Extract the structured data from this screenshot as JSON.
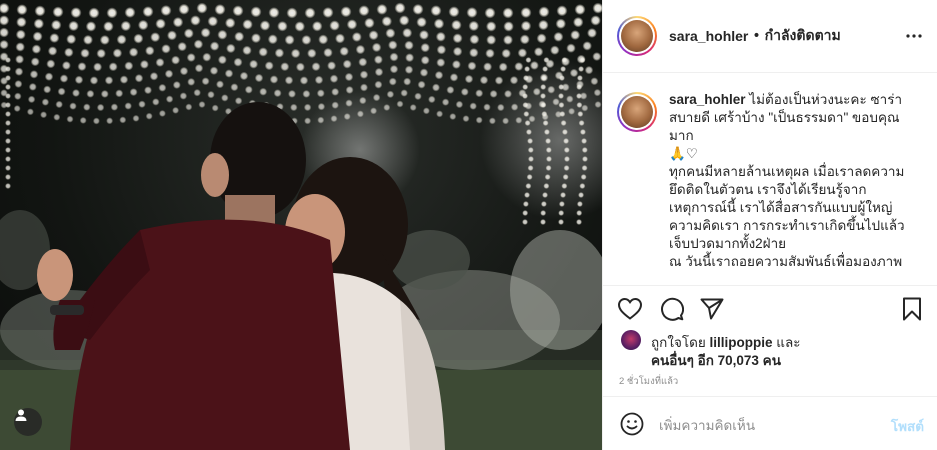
{
  "photo": {
    "alt_icon": "user-tag-icon"
  },
  "header": {
    "username": "sara_hohler",
    "separator": "•",
    "follow_status": "กำลังติดตาม",
    "more_icon": "more-options-icon"
  },
  "caption": {
    "username": "sara_hohler",
    "text": " ไม่ต้องเป็นห่วงนะคะ ซาร่าสบายดี เศร้าบ้าง \"เป็นธรรมดา\" ขอบคุณมาก\n🙏♡\nทุกคนมีหลายล้านเหตุผล เมื่อเราลดความยึดติดในตัวตน เราจึงได้เรียนรู้จากเหตุการณ์นี้ เราได้สื่อสารกันแบบผู้ใหญ่ ความคิดเรา การกระทำเราเกิดขึ้นไปแล้ว เจ็บปวดมากทั้ง2ฝ่าย\nณ วันนี้เราถอยความสัมพันธ์เพื่อมองภาพ"
  },
  "actions": {
    "like_icon": "heart-icon",
    "comment_icon": "comment-icon",
    "share_icon": "share-icon",
    "save_icon": "bookmark-icon"
  },
  "likes": {
    "prefix": "ถูกใจโดย ",
    "liker": "lillipoppie",
    "and": " และ",
    "others": "คนอื่นๆ อีก 70,073 คน"
  },
  "timestamp": "2 ชั่วโมงที่แล้ว",
  "comment_box": {
    "emoji_icon": "smiley-icon",
    "placeholder": "เพิ่มความคิดเห็น",
    "post_label": "โพสต์"
  }
}
